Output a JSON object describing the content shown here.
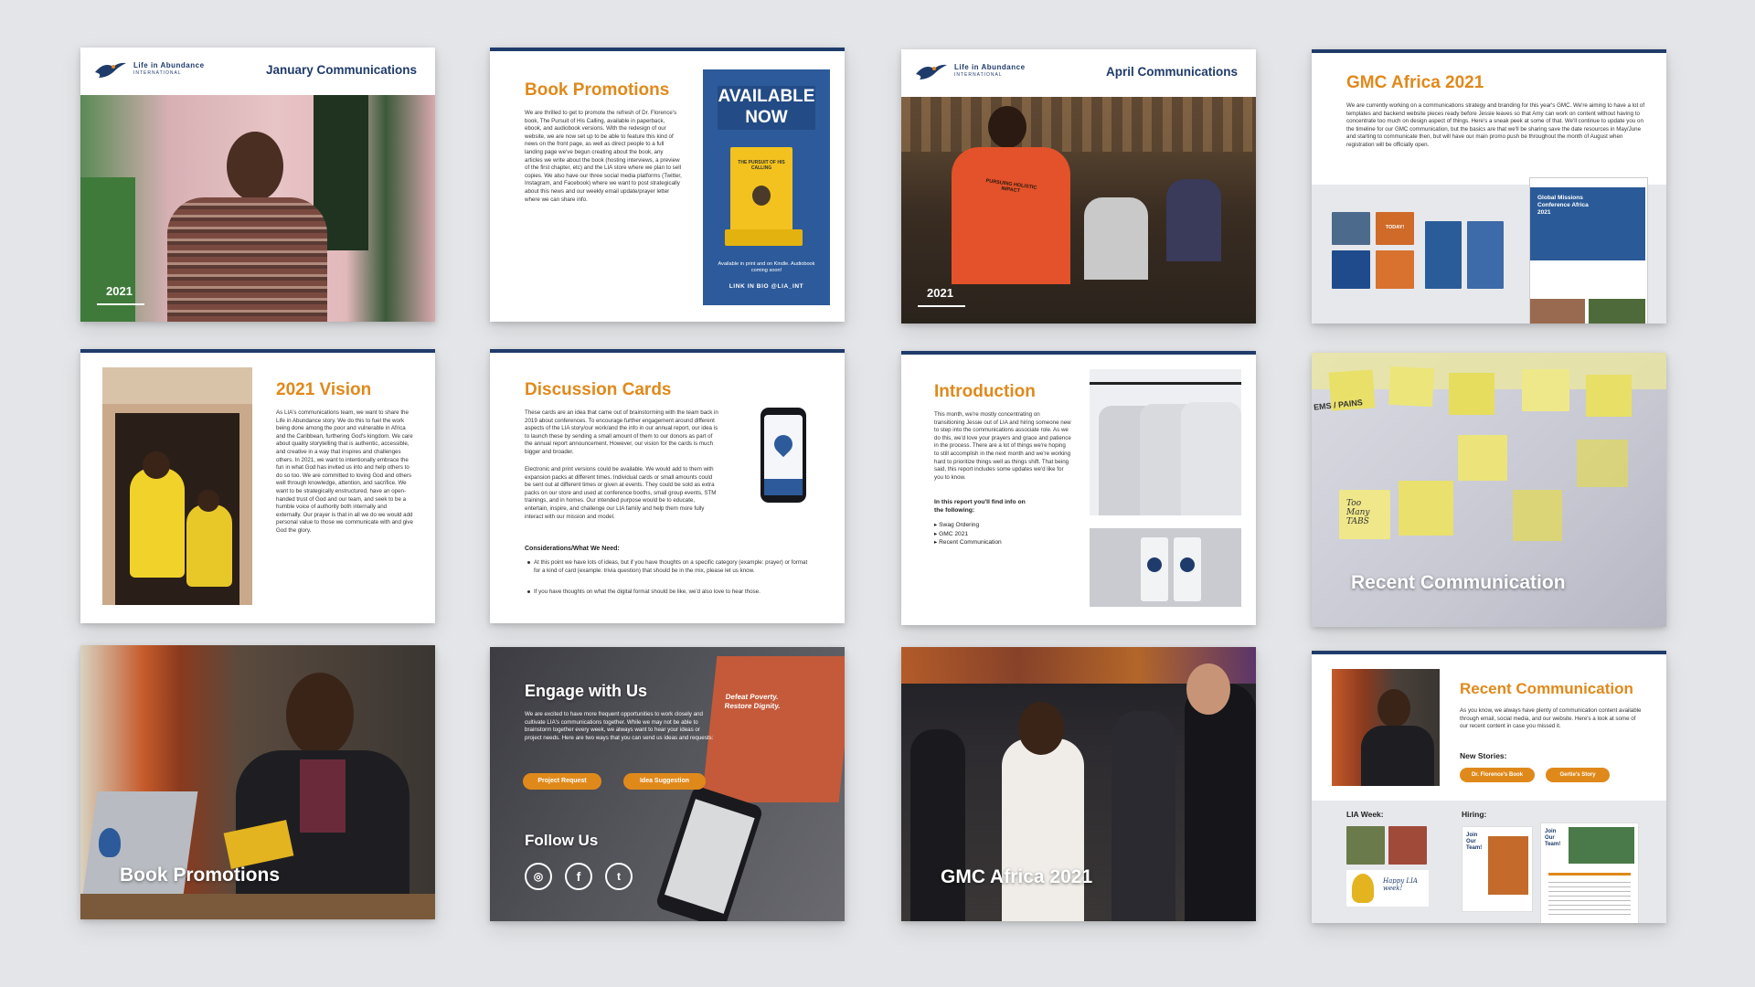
{
  "logo": {
    "name": "Life in Abundance",
    "sub": "INTERNATIONAL"
  },
  "slides": {
    "jan": {
      "header": "January Communications",
      "year": "2021"
    },
    "books": {
      "title": "Book Promotions",
      "body": "We are thrilled to get to promote the refresh of Dr. Florence's book, The Pursuit of His Calling, available in paperback, ebook, and audiobook versions. With the redesign of our website, we are now set up to be able to feature this kind of news on the front page, as well as direct people to a full landing page we've begun creating about the book, any articles we write about the book (hosting interviews, a preview of the first chapter, etc) and the LIA store where we plan to sell copies. We also have our three social media platforms (Twitter, Instagram, and Facebook) where we want to post strategically about this news and our weekly email update/prayer letter where we can share info.",
      "poster_head1": "AVAILABLE",
      "poster_head2": "NOW",
      "book_title": "THE PURSUIT OF HIS CALLING",
      "poster_foot": "Available in print and on Kindle. Audiobook coming soon!",
      "poster_link": "LINK IN BIO @LIA_INT"
    },
    "apr": {
      "header": "April Communications",
      "year": "2021",
      "shirt": "PURSUING HOLISTIC IMPACT"
    },
    "gmc": {
      "title": "GMC Africa 2021",
      "body": "We are currently working on a communications strategy and branding for this year's GMC. We're aiming to have a lot of templates and backend website pieces ready before Jessie leaves so that Amy can work on content without having to concentrate too much on design aspect of things. Here's a sneak peek at some of that. We'll continue to update you on the timeline for our GMC communication, but the basics are that we'll be sharing save the date resources in May/June and starting to communicate then, but will have our main promo push be throughout the month of August when registration will be officially open.",
      "thumb_label": "TODAY!",
      "web_title": "Global Missions Conference Africa 2021"
    },
    "vision": {
      "title": "2021 Vision",
      "body": "As LIA's communications team, we want to share the Life in Abundance story. We do this to fuel the work being done among the poor and vulnerable in Africa and the Caribbean, furthering God's kingdom. We care about quality storytelling that is authentic, accessible, and creative in a way that inspires and challenges others. In 2021, we want to intentionally embrace the fun in what God has invited us into and help others to do so too. We are committed to loving God and others well through knowledge, attention, and sacrifice. We want to be strategically enstructured, have an open-handed trust of God and our team, and seek to be a humble voice of authority both internally and externally. Our prayer is that in all we do we would add personal value to those we communicate with and give God the glory."
    },
    "cards": {
      "title": "Discussion Cards",
      "body": "These cards are an idea that came out of brainstorming with the team back in 2019 about conferences. To encourage further engagement around different aspects of the LIA story/our work/and the info in our annual report, our idea is to launch these by sending a small amount of them to our donors as part of the annual report announcement. However, our vision for the cards is much bigger and broader.",
      "body2": "Electronic and print versions could be available. We would add to them with expansion packs at different times. Individual cards or small amounts could be sent out at different times or given at events. They could be sold as extra packs on our store and used at conference booths, small group events, STM trainings, and in homes. Our intended purpose would be to educate, entertain, inspire, and challenge our LIA family and help them more fully interact with our mission and model.",
      "considerations": "Considerations/What We Need:",
      "bullets": [
        "At this point we have lots of ideas, but if you have thoughts on a specific category (example: prayer) or format for a kind of card (example: trivia question) that should be in the mix, please let us know.",
        "If you have thoughts on what the digital format should be like, we'd also love to hear those."
      ]
    },
    "intro": {
      "title": "Introduction",
      "body": "This month, we're mostly concentrating on transitioning Jessie out of LIA and hiring someone new to step into the communications associate role. As we do this, we'd love your prayers and grace and patience in the process. There are a lot of things we're hoping to still accomplish in the next month and we're working hard to prioritize things well as things shift. That being said, this report includes some updates we'd like for you to know.",
      "find_label": "In this report you'll find info on the following:",
      "items": [
        "Swag Ordering",
        "GMC 2021",
        "Recent Communication"
      ]
    },
    "recent_photo": {
      "label": "Recent Communication",
      "sticky1": "Too Many TABS",
      "sticky2": "EMS / PAINS"
    },
    "books_photo": {
      "label": "Book Promotions"
    },
    "engage": {
      "title": "Engage with Us",
      "body": "We are excited to have more frequent opportunities to work closely and cultivate LIA's communications together. While we may not be able to brainstorm together every week, we always want to hear your ideas or project needs. Here are two ways that you can send us ideas and requests:",
      "btn1": "Project Request",
      "btn2": "Idea Suggestion",
      "follow": "Follow Us",
      "screen_text": "Defeat Poverty. Restore Dignity."
    },
    "gmc_photo": {
      "label": "GMC Africa 2021"
    },
    "recent": {
      "title": "Recent Communication",
      "body": "As you know, we always have plenty of communication content available through email, social media, and our website. Here's a look at some of our recent content in case you missed it.",
      "stories_label": "New Stories:",
      "story1": "Dr. Florence's Book",
      "story2": "Gertie's Story",
      "week_label": "LIA Week:",
      "hiring_label": "Hiring:",
      "join_text": "Join Our Team!",
      "happy_text": "Happy LIA week!"
    }
  },
  "colors": {
    "navy": "#1f3b6b",
    "orange": "#e0891b",
    "background": "#e4e5e8"
  },
  "icons": [
    "instagram-icon",
    "facebook-icon",
    "twitter-icon",
    "phone-icon",
    "hanger-icon",
    "bird-logo-icon"
  ]
}
